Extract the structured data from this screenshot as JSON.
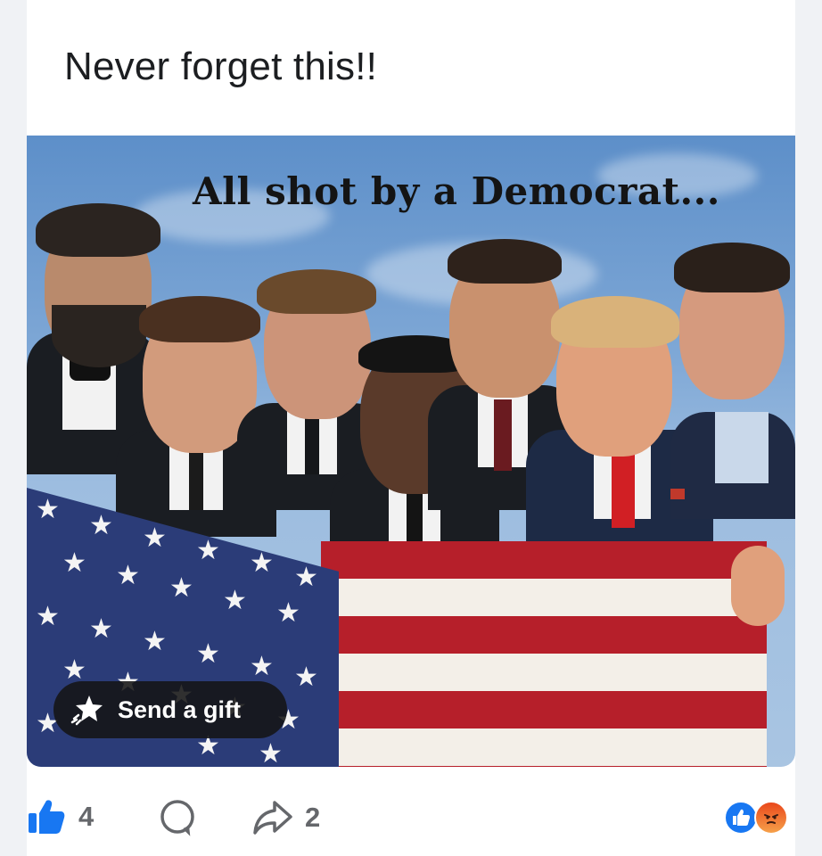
{
  "post": {
    "text": "Never forget this!!",
    "image_caption": "All shot by a Democrat..."
  },
  "gift_button": {
    "label": "Send a gift",
    "icon": "gift-icon"
  },
  "actions": {
    "like_count": "4",
    "like_icon": "thumbs-up-icon",
    "comment_icon": "comment-bubble-icon",
    "share_icon": "share-arrow-icon",
    "share_count": "2"
  },
  "reactions": {
    "icons": [
      "like-reaction-icon",
      "angry-reaction-icon"
    ],
    "colors": {
      "like": "#1877f2",
      "angry": "#f0643c"
    }
  },
  "colors": {
    "accent": "#1877f2",
    "text_primary": "#1c1e21",
    "text_secondary": "#65676b"
  }
}
